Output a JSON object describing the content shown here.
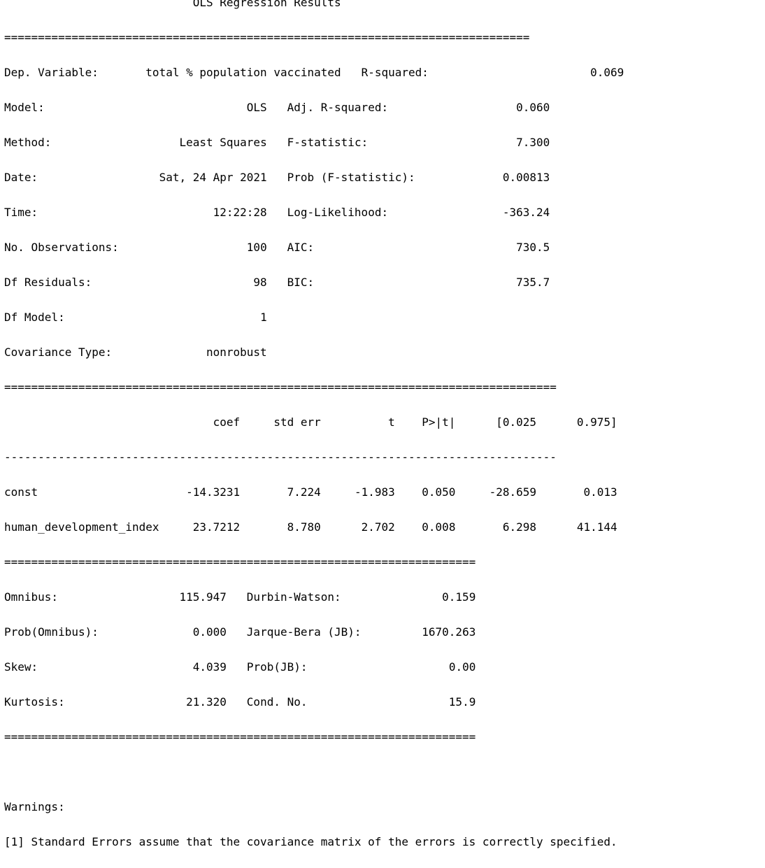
{
  "title": "OLS Regression Results",
  "rule_major": "==============================================================================",
  "rule_minor": "------------------------------------------------------------------------------",
  "header_left": [
    {
      "label": "Dep. Variable:",
      "value": "total % population vaccinated"
    },
    {
      "label": "Model:",
      "value": "OLS"
    },
    {
      "label": "Method:",
      "value": "Least Squares"
    },
    {
      "label": "Date:",
      "value": "Sat, 24 Apr 2021"
    },
    {
      "label": "Time:",
      "value": "12:22:28"
    },
    {
      "label": "No. Observations:",
      "value": "100"
    },
    {
      "label": "Df Residuals:",
      "value": "98"
    },
    {
      "label": "Df Model:",
      "value": "1"
    },
    {
      "label": "Covariance Type:",
      "value": "nonrobust"
    }
  ],
  "header_right": [
    {
      "label": "R-squared:",
      "value": "0.069"
    },
    {
      "label": "Adj. R-squared:",
      "value": "0.060"
    },
    {
      "label": "F-statistic:",
      "value": "7.300"
    },
    {
      "label": "Prob (F-statistic):",
      "value": "0.00813"
    },
    {
      "label": "Log-Likelihood:",
      "value": "-363.24"
    },
    {
      "label": "AIC:",
      "value": "730.5"
    },
    {
      "label": "BIC:",
      "value": "735.7"
    }
  ],
  "coef_columns": [
    "coef",
    "std err",
    "t",
    "P>|t|",
    "[0.025",
    "0.975]"
  ],
  "coef_rows": [
    {
      "name": "const",
      "values": [
        "-14.3231",
        "7.224",
        "-1.983",
        "0.050",
        "-28.659",
        "0.013"
      ]
    },
    {
      "name": "human_development_index",
      "values": [
        "23.7212",
        "8.780",
        "2.702",
        "0.008",
        "6.298",
        "41.144"
      ]
    }
  ],
  "diagnostics": [
    {
      "left_label": "Omnibus:",
      "left_value": "115.947",
      "right_label": "Durbin-Watson:",
      "right_value": "0.159"
    },
    {
      "left_label": "Prob(Omnibus):",
      "left_value": "0.000",
      "right_label": "Jarque-Bera (JB):",
      "right_value": "1670.263"
    },
    {
      "left_label": "Skew:",
      "left_value": "4.039",
      "right_label": "Prob(JB):",
      "right_value": "0.00"
    },
    {
      "left_label": "Kurtosis:",
      "left_value": "21.320",
      "right_label": "Cond. No.",
      "right_value": "15.9"
    }
  ],
  "warnings_heading": "Warnings:",
  "warnings": [
    "[1] Standard Errors assume that the covariance matrix of the errors is correctly specified."
  ]
}
